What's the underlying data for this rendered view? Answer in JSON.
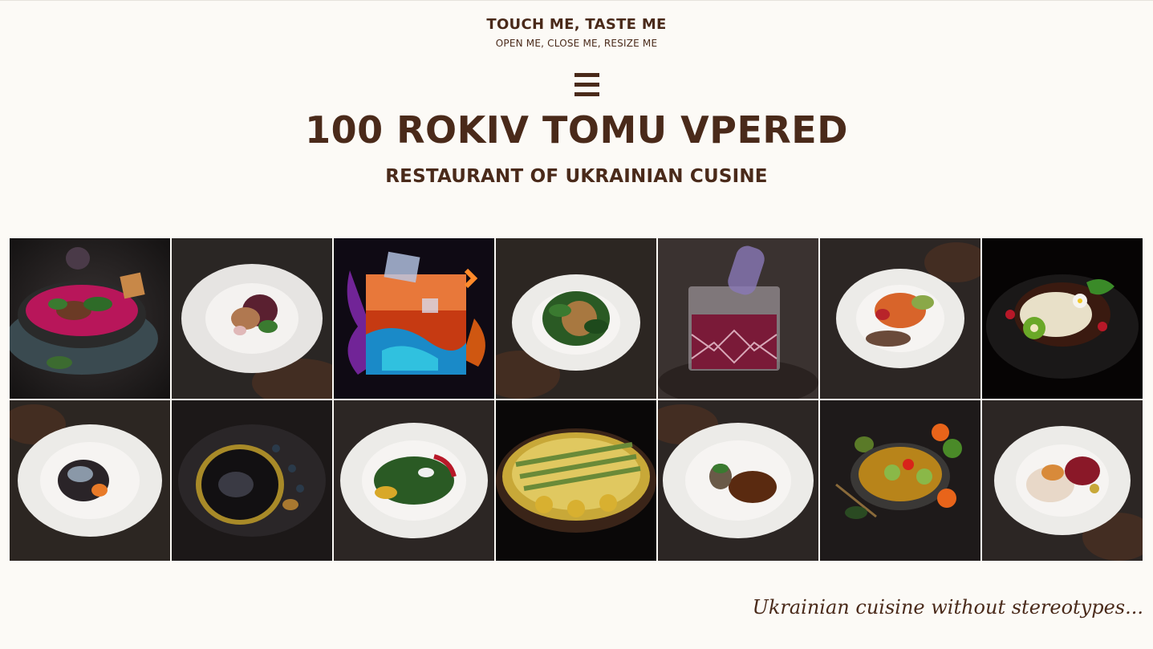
{
  "header": {
    "tagline": "TOUCH ME, TASTE ME",
    "subtagline": "OPEN ME, CLOSE ME, RESIZE ME",
    "menu_icon": "hamburger-icon",
    "title": "100 ROKIV TOMU VPERED",
    "subtitle": "RESTAURANT OF UKRAINIAN CUSINE"
  },
  "gallery": {
    "dishes": [
      "borscht-bowl-photo",
      "plated-salad-photo",
      "fiery-cocktail-photo",
      "greens-plate-photo",
      "crystal-glass-drink-photo",
      "vegetable-plate-photo",
      "dessert-kiwi-photo",
      "dark-rice-plate-photo",
      "black-plate-seafood-photo",
      "corn-salad-plate-photo",
      "baked-asparagus-dish-photo",
      "plate-with-sauce-photo",
      "avocado-salad-photo",
      "berries-plate-photo"
    ]
  },
  "footer": {
    "slogan": "Ukrainian cuisine without stereotypes..."
  },
  "colors": {
    "background": "#fcfaf6",
    "text": "#4a2a1a"
  }
}
